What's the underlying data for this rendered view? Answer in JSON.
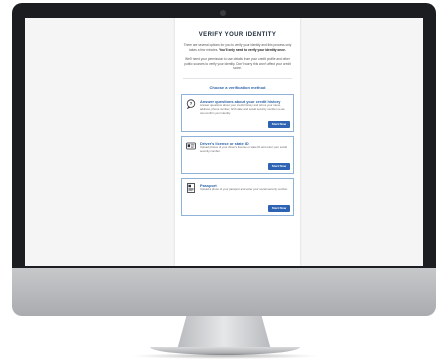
{
  "page": {
    "title": "VERIFY YOUR IDENTITY",
    "intro_1": "There are several options for you to verify your identity and this process only takes a few minutes.",
    "intro_1_bold": "You'll only need to verify your identity once.",
    "intro_2": "We'll need your permission to use details from your credit profile and other public sources to verify your identity. Don't worry this won't affect your credit score.",
    "choose_label": "Choose a verification method"
  },
  "options": [
    {
      "title": "Answer questions about your credit history",
      "description": "Answer questions about your credit history and tell us your name, address, phone number, birth date and social security number so we can confirm your identity.",
      "button": "Start Now",
      "icon": "question-bubble-icon"
    },
    {
      "title": "Driver's license or state ID",
      "description": "Upload photos of your driver's license or state ID and enter your social security number.",
      "button": "Start Now",
      "icon": "id-card-icon"
    },
    {
      "title": "Passport",
      "description": "Upload a photo of your passport and enter your social security number.",
      "button": "Start Now",
      "icon": "passport-icon"
    }
  ],
  "colors": {
    "accent": "#2d63a9",
    "button": "#2e63b3",
    "option_border": "#8fb2d8",
    "bezel": "#1b1d20"
  }
}
